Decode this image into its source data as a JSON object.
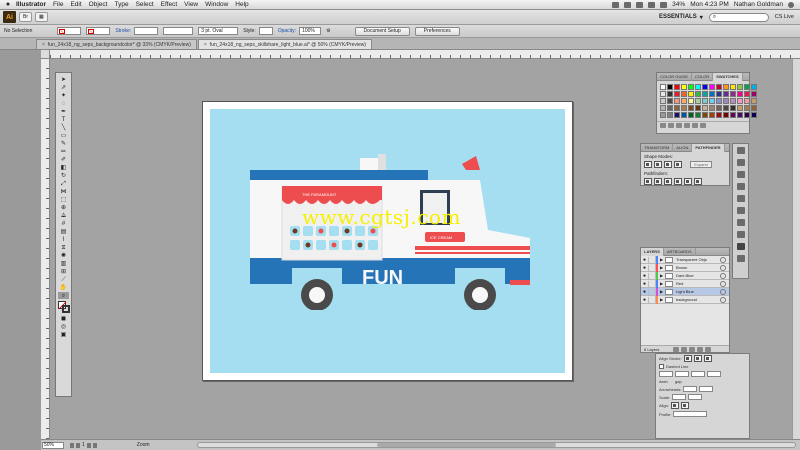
{
  "menubar": {
    "apple": "",
    "app_name": "Illustrator",
    "items": [
      "File",
      "Edit",
      "Object",
      "Type",
      "Select",
      "Effect",
      "View",
      "Window",
      "Help"
    ],
    "battery": "34%",
    "clock": "Mon 4:23 PM",
    "user": "Nathan Goldman"
  },
  "appbar": {
    "logo": "Ai",
    "bridge_label": "Br",
    "workspace": "ESSENTIALS",
    "search_placeholder": "",
    "cs_live": "CS Live"
  },
  "controlbar": {
    "selection_label": "No Selection",
    "stroke_label": "Stroke:",
    "stroke_dd_value": "",
    "brush_value": "3 pt. Oval",
    "style_label": "Style:",
    "opacity_label": "Opacity:",
    "opacity_value": "100",
    "opacity_unit": "%",
    "document_setup": "Document Setup",
    "preferences": "Preferences"
  },
  "tabs": [
    {
      "label": "fun_24x18_ng_seps_backgroundcolor* @ 33% (CMYK/Preview)",
      "close": "×"
    },
    {
      "label": "fun_24x18_ng_seps_skillshare_light_blue.ai* @ 50% (CMYK/Preview)",
      "close": "×"
    }
  ],
  "title_doc": "fun_24x18_ng_seps_skillshare_light_blue.ai* @ 50% (CMYK/Preview)",
  "watermark": "www.cgtsj.com",
  "artwork": {
    "sign_text": "THE PARAMOUNT",
    "logo_text": "FUN",
    "door_sign": "ICE CREAM"
  },
  "colors": {
    "sky": "#a4def0",
    "truck_white": "#f7f7f7",
    "truck_blue": "#2574b8",
    "accent_red": "#ee4d4f",
    "wheel_dark": "#4a4a4a"
  },
  "swatches_panel": {
    "tabs": [
      "Color Guide",
      "Color",
      "Swatches"
    ],
    "colors": [
      "#ffffff",
      "#000000",
      "#ff0000",
      "#ffff00",
      "#00ff00",
      "#00ffff",
      "#0000ff",
      "#ff00ff",
      "#c9002b",
      "#f7941d",
      "#ffe600",
      "#8dc63f",
      "#00a651",
      "#00aeef",
      "#e6e6e6",
      "#333333",
      "#ed1c24",
      "#f26522",
      "#fff200",
      "#39b54a",
      "#00a99d",
      "#0072bc",
      "#2e3192",
      "#662d91",
      "#92278f",
      "#ec008c",
      "#ed145b",
      "#9e005d",
      "#cccccc",
      "#4d4d4d",
      "#f69679",
      "#fbaf5d",
      "#fff799",
      "#a3d39c",
      "#7accc8",
      "#6dcff6",
      "#8393ca",
      "#a187be",
      "#bd8cbf",
      "#f49ac1",
      "#f6989d",
      "#c69c6d",
      "#b3b3b3",
      "#666666",
      "#8c6239",
      "#a67c52",
      "#754c24",
      "#603913",
      "#c7b299",
      "#998675",
      "#736357",
      "#534741",
      "#362f2d",
      "#c69c6d",
      "#a67c52",
      "#8c6239",
      "#999999",
      "#808080",
      "#1b1464",
      "#0054a6",
      "#005e20",
      "#197b30",
      "#7d4900",
      "#a0410d",
      "#9e0b0f",
      "#790000",
      "#630460",
      "#440e62",
      "#32004b",
      "#0d004c"
    ]
  },
  "pathfinder_panel": {
    "tabs": [
      "Transform",
      "Align",
      "Pathfinder"
    ],
    "shape_modes_label": "Shape Modes:",
    "expand_label": "Expand",
    "pathfinders_label": "Pathfinders:"
  },
  "layers_panel": {
    "tabs": [
      "Layers",
      "Artboards"
    ],
    "layers": [
      {
        "name": "Transparent Objs",
        "color": "#4f80ff",
        "selected": false
      },
      {
        "name": "Brown",
        "color": "#ff4f4f",
        "selected": false
      },
      {
        "name": "Dark Blue",
        "color": "#4fc84f",
        "selected": false
      },
      {
        "name": "Red",
        "color": "#4f80ff",
        "selected": false
      },
      {
        "name": "Light Blue",
        "color": "#d84fd8",
        "selected": true
      },
      {
        "name": "background",
        "color": "#ff8a4f",
        "selected": false
      }
    ],
    "count_label": "6 Layers"
  },
  "stroke_panel": {
    "align_stroke_label": "Align Stroke:",
    "dashed_line_label": "Dashed Line",
    "dash_label": "dash",
    "gap_label": "gap",
    "arrowheads_label": "Arrowheads:",
    "scale_label": "Scale:",
    "align_label": "Align:",
    "profile_label": "Profile:"
  },
  "statusbar": {
    "zoom": "50%",
    "page": "1",
    "tool": "Zoom"
  }
}
